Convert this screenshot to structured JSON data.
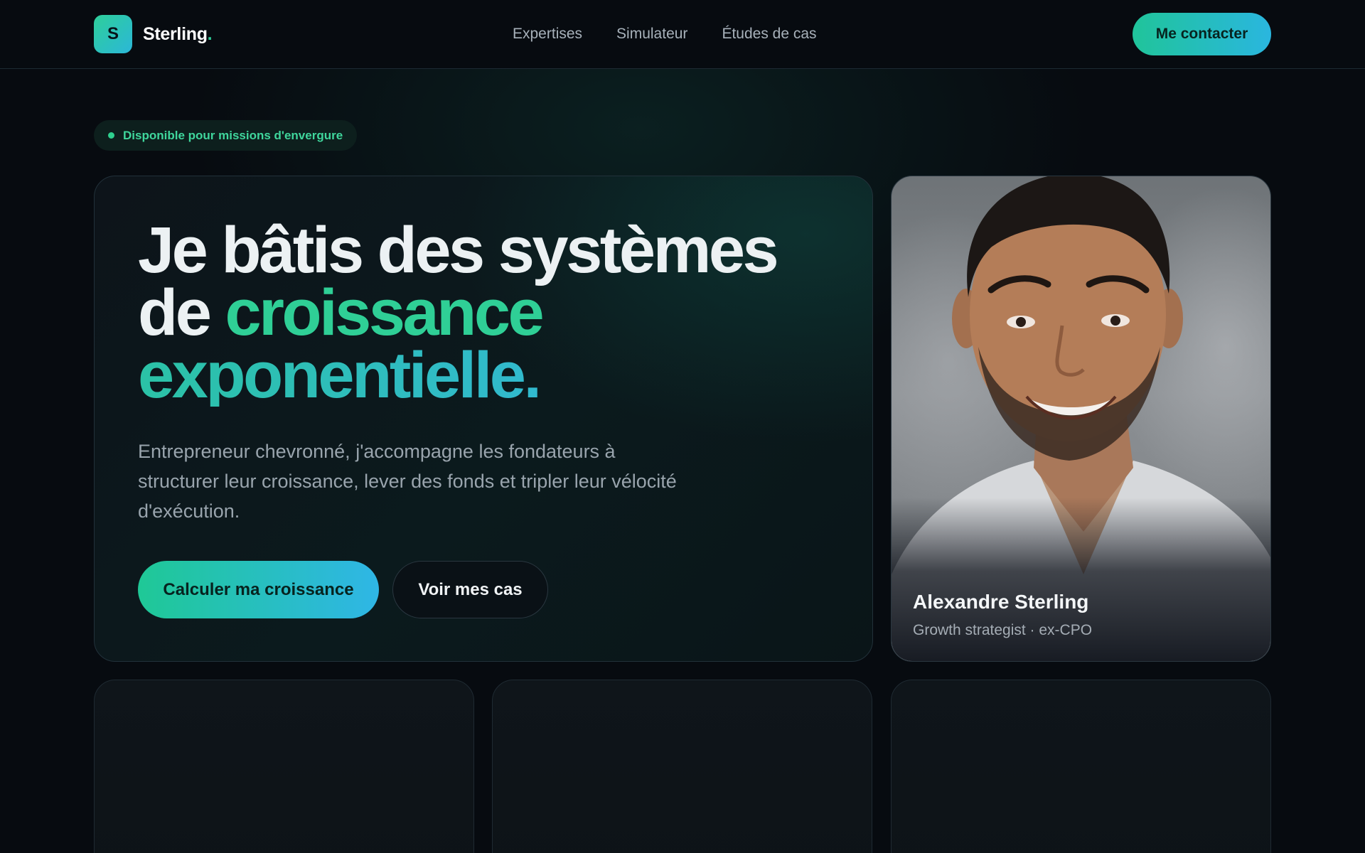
{
  "header": {
    "logo_letter": "S",
    "brand_name": "Sterling",
    "brand_dot": ".",
    "nav": [
      "Expertises",
      "Simulateur",
      "Études de cas"
    ],
    "contact_label": "Me contacter"
  },
  "badge": {
    "label": "Disponible pour missions d'envergure"
  },
  "hero": {
    "headline_line1": "Je bâtis des systèmes",
    "headline_line2_prefix": "de ",
    "headline_accent": "croissance",
    "headline_line3": "exponentielle.",
    "subtitle": "Entrepreneur chevronné, j'accompagne les fondateurs à structurer leur croissance, lever des fonds et tripler leur vélocité d'exécution.",
    "cta_primary": "Calculer ma croissance",
    "cta_secondary": "Voir mes cas"
  },
  "profile": {
    "name": "Alexandre Sterling",
    "role": "Growth strategist · ex-CPO"
  },
  "colors": {
    "accent_green": "#2fcf96",
    "accent_blue": "#35b4e6",
    "background": "#070b10"
  }
}
